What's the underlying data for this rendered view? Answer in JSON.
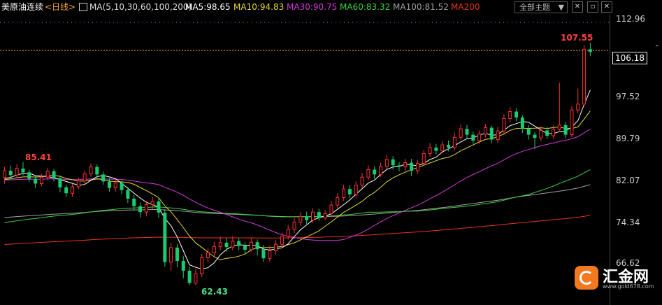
{
  "header": {
    "instrument": "美原油连续",
    "period": "<日线>",
    "ma_params": "MA(5,10,30,60,100,200)",
    "ma5": "MA5:98.65",
    "ma10": "MA10:94.83",
    "ma30": "MA30:90.75",
    "ma60": "MA60:83.32",
    "ma100": "MA100:81.52",
    "ma200": "MA200",
    "theme_label": "全部主题",
    "theme_caret": "▼"
  },
  "colors": {
    "up": "#ff3030",
    "down": "#19cc6e",
    "ma5": "#ffffff",
    "ma10": "#e6d83a",
    "ma30": "#d23ad8",
    "ma60": "#3fcf3f",
    "ma100": "#a0a0a0",
    "ma200": "#e8341e",
    "grid": "#1f4d7a"
  },
  "axis": {
    "ticks": [
      "112.96",
      "97.52",
      "89.79",
      "82.07",
      "74.34",
      "66.62"
    ],
    "current_price": "106.18"
  },
  "annotations": {
    "high_label": "107.55",
    "low_label": "62.43",
    "left_peak_label": "85.41"
  },
  "watermark": {
    "name": "汇金网",
    "url": "www.gold678.com"
  },
  "chart_data": {
    "type": "candlestick",
    "y_ticks": [
      112.96,
      97.52,
      89.79,
      82.07,
      74.34,
      66.62
    ],
    "current_price": 106.18,
    "high": 107.55,
    "low": 62.43,
    "series": [
      {
        "name": "MA5",
        "value": 98.65
      },
      {
        "name": "MA10",
        "value": 94.83
      },
      {
        "name": "MA30",
        "value": 90.75
      },
      {
        "name": "MA60",
        "value": 83.32
      },
      {
        "name": "MA100",
        "value": 81.52
      },
      {
        "name": "MA200"
      }
    ],
    "candles": [
      [
        82.5,
        83.8,
        81.4,
        84.5
      ],
      [
        83.8,
        83.0,
        82.2,
        84.8
      ],
      [
        83.0,
        84.2,
        82.6,
        85.0
      ],
      [
        84.2,
        83.5,
        82.9,
        85.41
      ],
      [
        83.5,
        82.3,
        81.7,
        84.0
      ],
      [
        82.3,
        81.4,
        80.6,
        82.9
      ],
      [
        81.4,
        82.6,
        80.9,
        83.2
      ],
      [
        82.6,
        83.7,
        82.0,
        84.3
      ],
      [
        83.7,
        82.4,
        81.8,
        84.1
      ],
      [
        82.4,
        80.7,
        79.8,
        82.9
      ],
      [
        80.7,
        79.6,
        78.9,
        81.2
      ],
      [
        79.6,
        80.8,
        79.0,
        81.4
      ],
      [
        80.8,
        81.9,
        80.3,
        82.5
      ],
      [
        81.9,
        83.2,
        81.4,
        83.8
      ],
      [
        83.2,
        84.5,
        82.7,
        85.1
      ],
      [
        84.5,
        83.1,
        82.3,
        85.0
      ],
      [
        83.1,
        81.8,
        81.2,
        83.6
      ],
      [
        81.8,
        80.6,
        79.9,
        82.4
      ],
      [
        80.6,
        81.5,
        79.9,
        82.1
      ],
      [
        81.5,
        80.2,
        79.4,
        82.0
      ],
      [
        80.2,
        78.6,
        77.8,
        80.8
      ],
      [
        78.6,
        77.2,
        76.4,
        79.3
      ],
      [
        77.2,
        76.1,
        75.1,
        77.9
      ],
      [
        76.1,
        77.5,
        75.3,
        78.2
      ],
      [
        77.5,
        78.1,
        76.6,
        78.9
      ],
      [
        78.1,
        76.0,
        75.0,
        78.8
      ],
      [
        76.0,
        66.8,
        65.9,
        76.7
      ],
      [
        66.8,
        69.5,
        65.2,
        70.4
      ],
      [
        69.5,
        67.0,
        65.8,
        70.2
      ],
      [
        67.0,
        65.2,
        63.8,
        67.9
      ],
      [
        65.2,
        62.9,
        62.43,
        66.0
      ],
      [
        62.9,
        64.6,
        62.5,
        65.5
      ],
      [
        64.6,
        67.6,
        64.0,
        68.3
      ],
      [
        67.6,
        68.5,
        66.7,
        69.4
      ],
      [
        68.5,
        69.7,
        67.8,
        70.6
      ],
      [
        69.7,
        70.4,
        69.0,
        71.5
      ],
      [
        70.4,
        69.6,
        68.7,
        71.2
      ],
      [
        69.6,
        70.7,
        69.0,
        71.6
      ],
      [
        70.7,
        69.8,
        69.0,
        71.3
      ],
      [
        69.8,
        69.1,
        68.3,
        70.5
      ],
      [
        69.1,
        70.5,
        68.6,
        71.2
      ],
      [
        70.5,
        69.2,
        68.0,
        71.0
      ],
      [
        69.2,
        67.5,
        66.8,
        70.0
      ],
      [
        67.5,
        68.9,
        66.9,
        69.8
      ],
      [
        68.9,
        70.1,
        68.2,
        70.9
      ],
      [
        70.1,
        71.6,
        69.6,
        72.3
      ],
      [
        71.6,
        72.9,
        71.0,
        73.7
      ],
      [
        72.9,
        74.2,
        72.2,
        75.0
      ],
      [
        74.2,
        75.3,
        73.6,
        76.1
      ],
      [
        75.3,
        74.6,
        73.9,
        76.2
      ],
      [
        74.6,
        76.1,
        74.1,
        76.8
      ],
      [
        76.1,
        75.0,
        74.4,
        76.7
      ],
      [
        75.0,
        75.8,
        74.6,
        76.5
      ],
      [
        75.8,
        77.4,
        75.1,
        78.2
      ],
      [
        77.4,
        78.8,
        76.9,
        79.6
      ],
      [
        78.8,
        80.4,
        78.2,
        81.2
      ],
      [
        80.4,
        79.4,
        78.7,
        81.1
      ],
      [
        79.4,
        81.1,
        78.8,
        81.8
      ],
      [
        81.1,
        82.6,
        80.6,
        83.4
      ],
      [
        82.6,
        84.0,
        82.0,
        84.8
      ],
      [
        84.0,
        83.1,
        82.3,
        84.6
      ],
      [
        83.1,
        84.6,
        82.6,
        85.3
      ],
      [
        84.6,
        85.9,
        84.1,
        86.8
      ],
      [
        85.9,
        84.8,
        84.0,
        86.5
      ],
      [
        84.8,
        84.5,
        83.7,
        85.4
      ],
      [
        84.5,
        85.3,
        83.8,
        86.0
      ],
      [
        85.3,
        83.8,
        82.8,
        86.0
      ],
      [
        83.8,
        85.2,
        83.2,
        85.8
      ],
      [
        85.2,
        87.0,
        84.7,
        87.6
      ],
      [
        87.0,
        88.1,
        86.4,
        88.9
      ],
      [
        88.1,
        87.5,
        86.8,
        88.8
      ],
      [
        87.5,
        88.6,
        87.0,
        89.3
      ],
      [
        88.6,
        88.1,
        87.4,
        89.4
      ],
      [
        88.1,
        90.0,
        87.6,
        90.9
      ],
      [
        90.0,
        91.6,
        89.5,
        92.4
      ],
      [
        91.6,
        90.5,
        89.8,
        92.3
      ],
      [
        90.5,
        89.4,
        88.8,
        91.1
      ],
      [
        89.4,
        90.6,
        88.8,
        91.3
      ],
      [
        90.6,
        91.8,
        90.0,
        92.5
      ],
      [
        91.8,
        89.6,
        88.9,
        92.2
      ],
      [
        89.6,
        91.2,
        89.0,
        92.0
      ],
      [
        91.2,
        93.5,
        90.7,
        94.3
      ],
      [
        93.5,
        94.8,
        92.9,
        95.6
      ],
      [
        94.8,
        93.7,
        93.0,
        95.4
      ],
      [
        93.7,
        91.6,
        90.8,
        94.1
      ],
      [
        91.6,
        90.5,
        89.6,
        92.3
      ],
      [
        90.5,
        89.9,
        87.8,
        91.0
      ],
      [
        89.9,
        91.3,
        89.3,
        92.1
      ],
      [
        91.3,
        90.3,
        89.7,
        92.0
      ],
      [
        90.3,
        91.5,
        89.8,
        92.2
      ],
      [
        91.5,
        92.3,
        91.0,
        100.2
      ],
      [
        92.3,
        90.5,
        89.8,
        92.9
      ],
      [
        90.5,
        95.1,
        90.0,
        95.8
      ],
      [
        95.1,
        96.2,
        94.5,
        99.1
      ],
      [
        96.2,
        106.4,
        96.0,
        107.2
      ],
      [
        106.4,
        105.9,
        105.1,
        107.55
      ]
    ]
  }
}
